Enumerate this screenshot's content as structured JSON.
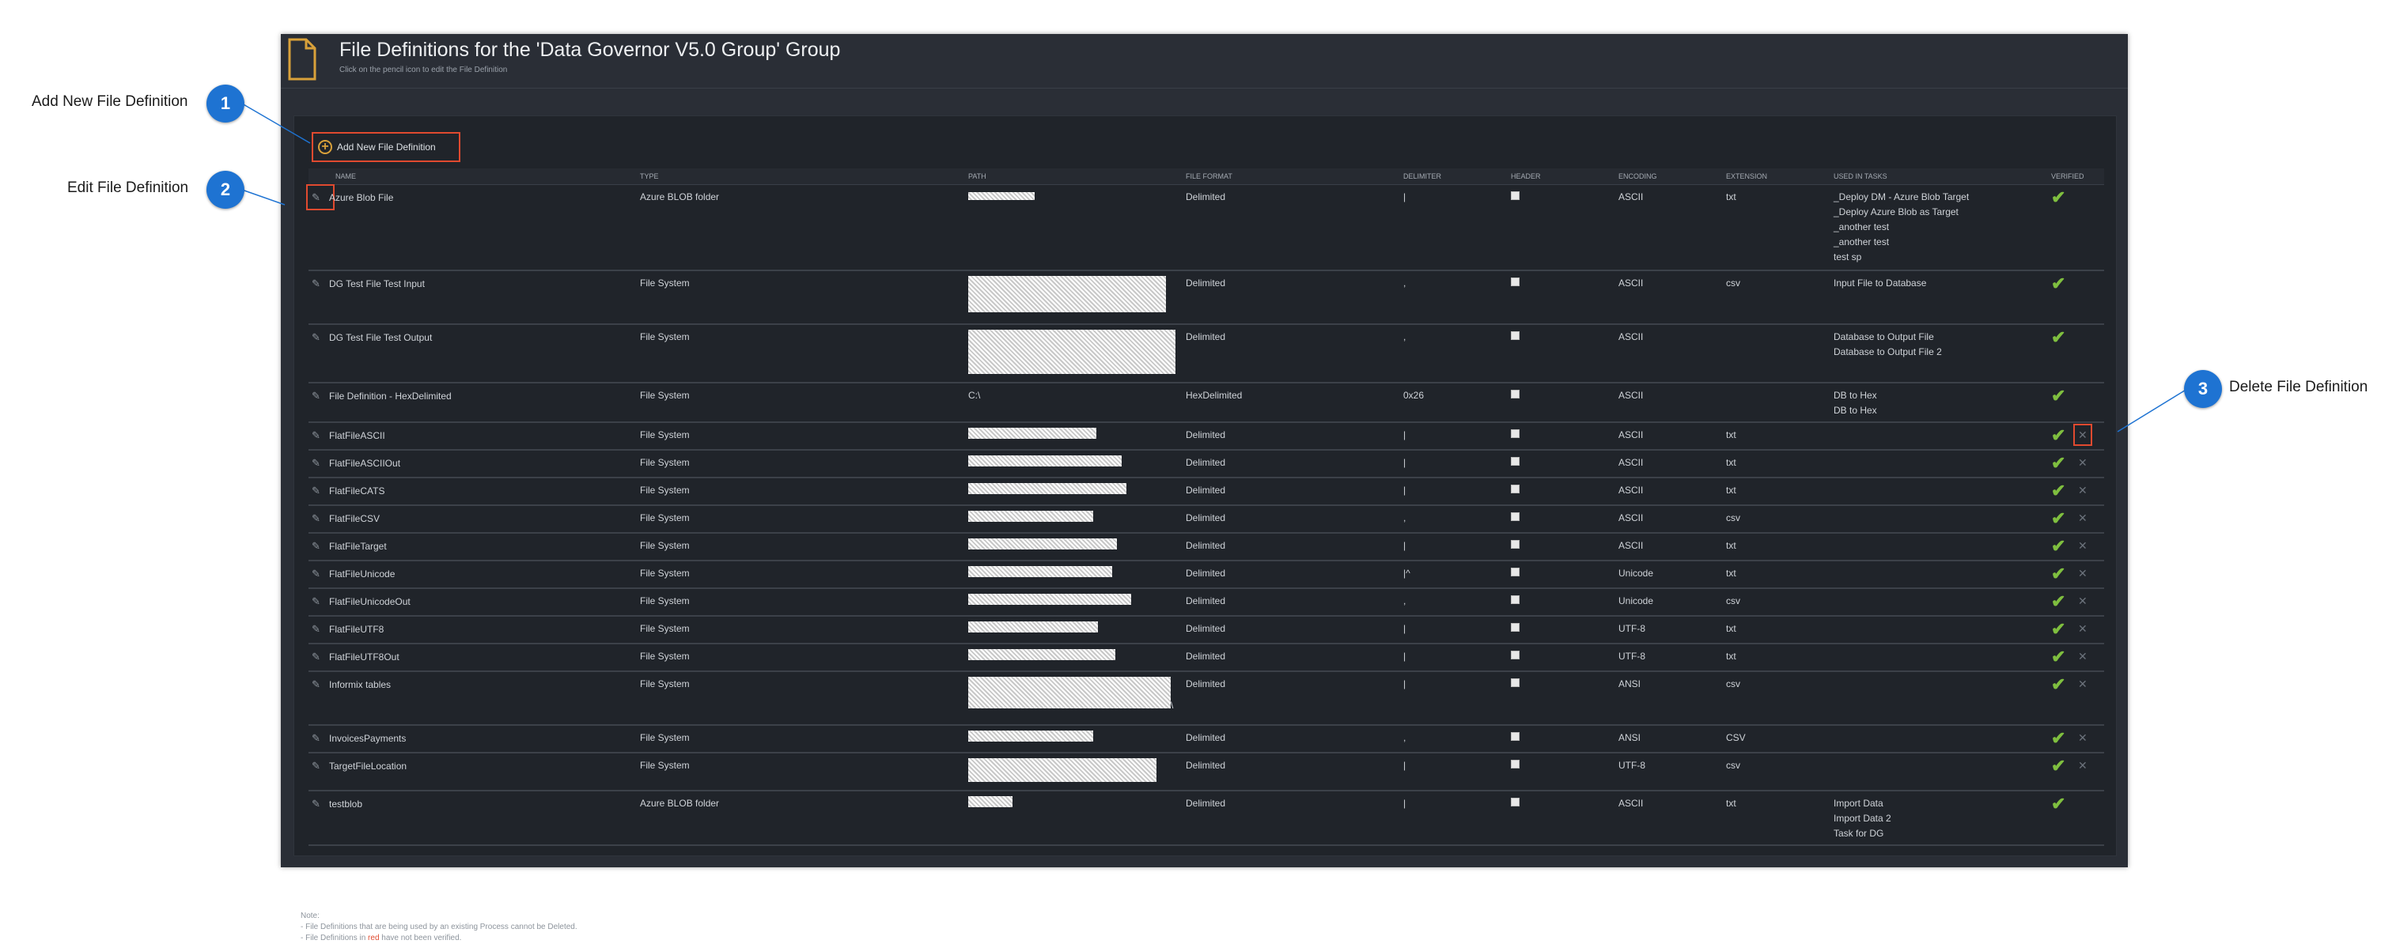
{
  "header": {
    "title": "File Definitions for the 'Data Governor V5.0 Group' Group",
    "subtitle": "Click on the pencil icon to edit the File Definition"
  },
  "toolbar": {
    "add_label": "Add New File Definition"
  },
  "columns": [
    "NAME",
    "TYPE",
    "PATH",
    "FILE FORMAT",
    "DELIMITER",
    "HEADER",
    "ENCODING",
    "EXTENSION",
    "USED IN TASKS",
    "VERIFIED"
  ],
  "rows": [
    {
      "name": "Azure Blob File",
      "type": "Azure BLOB folder",
      "path": "",
      "format": "Delimited",
      "delimiter": "|",
      "header": true,
      "encoding": "ASCII",
      "extension": "txt",
      "tasks": [
        "_Deploy DM - Azure Blob Target",
        "_Deploy Azure Blob as Target",
        "_another test",
        "_another test",
        "test sp"
      ],
      "verified": true,
      "deletable": false
    },
    {
      "name": "DG Test File Test Input",
      "type": "File System",
      "path": "",
      "format": "Delimited",
      "delimiter": ",",
      "header": true,
      "encoding": "ASCII",
      "extension": "csv",
      "tasks": [
        "Input File to Database"
      ],
      "verified": true,
      "deletable": false
    },
    {
      "name": "DG Test File Test Output",
      "type": "File System",
      "path": "",
      "format": "Delimited",
      "delimiter": ",",
      "header": true,
      "encoding": "ASCII",
      "extension": "",
      "tasks": [
        "Database to Output File",
        "Database to Output File 2"
      ],
      "verified": true,
      "deletable": false
    },
    {
      "name": "File Definition - HexDelimited",
      "type": "File System",
      "path": "C:\\",
      "format": "HexDelimited",
      "delimiter": "0x26",
      "header": true,
      "encoding": "ASCII",
      "extension": "",
      "tasks": [
        "DB to Hex",
        "DB to Hex"
      ],
      "verified": true,
      "deletable": false
    },
    {
      "name": "FlatFileASCII",
      "type": "File System",
      "path": "",
      "format": "Delimited",
      "delimiter": "|",
      "header": true,
      "encoding": "ASCII",
      "extension": "txt",
      "tasks": [],
      "verified": true,
      "deletable": true
    },
    {
      "name": "FlatFileASCIIOut",
      "type": "File System",
      "path": "",
      "format": "Delimited",
      "delimiter": "|",
      "header": true,
      "encoding": "ASCII",
      "extension": "txt",
      "tasks": [],
      "verified": true,
      "deletable": true
    },
    {
      "name": "FlatFileCATS",
      "type": "File System",
      "path": "",
      "format": "Delimited",
      "delimiter": "|",
      "header": true,
      "encoding": "ASCII",
      "extension": "txt",
      "tasks": [],
      "verified": true,
      "deletable": true
    },
    {
      "name": "FlatFileCSV",
      "type": "File System",
      "path": "",
      "format": "Delimited",
      "delimiter": ",",
      "header": true,
      "encoding": "ASCII",
      "extension": "csv",
      "tasks": [],
      "verified": true,
      "deletable": true
    },
    {
      "name": "FlatFileTarget",
      "type": "File System",
      "path": "",
      "format": "Delimited",
      "delimiter": "|",
      "header": true,
      "encoding": "ASCII",
      "extension": "txt",
      "tasks": [],
      "verified": true,
      "deletable": true
    },
    {
      "name": "FlatFileUnicode",
      "type": "File System",
      "path": "",
      "format": "Delimited",
      "delimiter": "|^",
      "header": true,
      "encoding": "Unicode",
      "extension": "txt",
      "tasks": [],
      "verified": true,
      "deletable": true
    },
    {
      "name": "FlatFileUnicodeOut",
      "type": "File System",
      "path": "",
      "format": "Delimited",
      "delimiter": ",",
      "header": true,
      "encoding": "Unicode",
      "extension": "csv",
      "tasks": [],
      "verified": true,
      "deletable": true
    },
    {
      "name": "FlatFileUTF8",
      "type": "File System",
      "path": "",
      "format": "Delimited",
      "delimiter": "|",
      "header": true,
      "encoding": "UTF-8",
      "extension": "txt",
      "tasks": [],
      "verified": true,
      "deletable": true
    },
    {
      "name": "FlatFileUTF8Out",
      "type": "File System",
      "path": "",
      "format": "Delimited",
      "delimiter": "|",
      "header": true,
      "encoding": "UTF-8",
      "extension": "txt",
      "tasks": [],
      "verified": true,
      "deletable": true
    },
    {
      "name": "Informix tables",
      "type": "File System",
      "path": "\\",
      "format": "Delimited",
      "delimiter": "|",
      "header": true,
      "encoding": "ANSI",
      "extension": "csv",
      "tasks": [],
      "verified": true,
      "deletable": true
    },
    {
      "name": "InvoicesPayments",
      "type": "File System",
      "path": "",
      "format": "Delimited",
      "delimiter": ",",
      "header": true,
      "encoding": "ANSI",
      "extension": "CSV",
      "tasks": [],
      "verified": true,
      "deletable": true
    },
    {
      "name": "TargetFileLocation",
      "type": "File System",
      "path": "",
      "format": "Delimited",
      "delimiter": "|",
      "header": true,
      "encoding": "UTF-8",
      "extension": "csv",
      "tasks": [],
      "verified": true,
      "deletable": true
    },
    {
      "name": "testblob",
      "type": "Azure BLOB folder",
      "path": "",
      "format": "Delimited",
      "delimiter": "|",
      "header": true,
      "encoding": "ASCII",
      "extension": "txt",
      "tasks": [
        "Import Data",
        "Import Data 2",
        "Task for DG"
      ],
      "verified": true,
      "deletable": false
    }
  ],
  "notes": {
    "title": "Note:",
    "line1": "- File Definitions that are being used by an existing Process cannot be Deleted.",
    "line2_pre": "- File Definitions in",
    "line2_red": "red",
    "line2_post": "have not been verified."
  },
  "callouts": [
    {
      "number": "1",
      "label": "Add New File Definition"
    },
    {
      "number": "2",
      "label": "Edit File Definition"
    },
    {
      "number": "3",
      "label": "Delete File Definition"
    }
  ],
  "colors": {
    "accent": "#1e73d2",
    "highlight": "#e04a2f",
    "check": "#7fbf3f",
    "panel": "#2a2e36"
  }
}
